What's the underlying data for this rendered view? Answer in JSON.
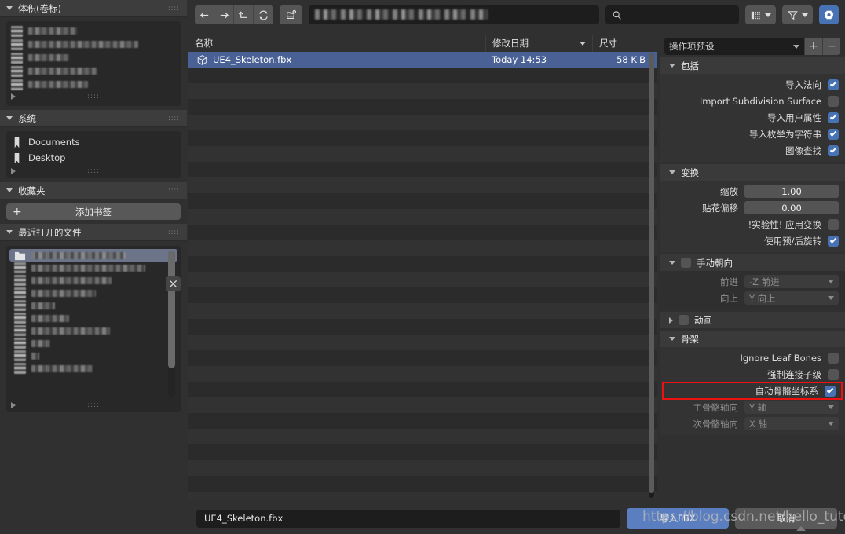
{
  "sidebar": {
    "volumes": {
      "title": "体积(卷标)",
      "items_blurred": 5
    },
    "system": {
      "title": "系统",
      "items": [
        {
          "label": "Documents",
          "icon": "bookmark-icon"
        },
        {
          "label": "Desktop",
          "icon": "bookmark-icon"
        }
      ]
    },
    "favorites": {
      "title": "收藏夹",
      "add_bookmark_label": "添加书签",
      "plus": "+"
    },
    "recent": {
      "title": "最近打开的文件",
      "rows_blurred": 11,
      "close_icon": "close-icon"
    }
  },
  "toolbar": {
    "back_icon": "arrow-left-icon",
    "forward_icon": "arrow-right-icon",
    "up_icon": "arrow-up-icon",
    "refresh_icon": "refresh-icon",
    "new_folder_icon": "new-folder-icon",
    "path_value": "",
    "search_placeholder": "",
    "search_icon": "search-icon",
    "display_mode_icon": "list-view-icon",
    "filter_icon": "filter-icon",
    "settings_icon": "gear-icon"
  },
  "filelist": {
    "columns": [
      "名称",
      "修改日期",
      "尺寸"
    ],
    "sort_column": "修改日期",
    "rows": [
      {
        "name": "UE4_Skeleton.fbx",
        "date": "Today 14:53",
        "size": "58 KiB",
        "icon": "mesh-cube-icon",
        "selected": true
      }
    ],
    "empty_row_count": 28
  },
  "rightpanel": {
    "preset": {
      "label": "操作项预设",
      "add": "+",
      "remove": "−"
    },
    "sections": [
      {
        "title": "包括",
        "expanded": true,
        "props": [
          {
            "label": "导入法向",
            "type": "checkbox",
            "checked": true
          },
          {
            "label": "Import Subdivision Surface",
            "type": "checkbox",
            "checked": false
          },
          {
            "label": "导入用户属性",
            "type": "checkbox",
            "checked": true
          },
          {
            "label": "导入枚举为字符串",
            "type": "checkbox",
            "checked": true
          },
          {
            "label": "图像查找",
            "type": "checkbox",
            "checked": true
          }
        ]
      },
      {
        "title": "变换",
        "expanded": true,
        "props": [
          {
            "label": "缩放",
            "type": "value",
            "value": "1.00"
          },
          {
            "label": "贴花偏移",
            "type": "value",
            "value": "0.00"
          },
          {
            "label": "!实验性! 应用变换",
            "type": "checkbox",
            "checked": false
          },
          {
            "label": "使用预/后旋转",
            "type": "checkbox",
            "checked": true
          }
        ]
      },
      {
        "title": "手动朝向",
        "expanded": true,
        "has_checkbox": true,
        "checked": false,
        "props": [
          {
            "label": "前进",
            "type": "select",
            "value": "-Z 前进",
            "disabled": true
          },
          {
            "label": "向上",
            "type": "select",
            "value": "Y 向上",
            "disabled": true
          }
        ]
      },
      {
        "title": "动画",
        "expanded": false,
        "has_checkbox": true,
        "checked": false,
        "props": []
      },
      {
        "title": "骨架",
        "expanded": true,
        "props": [
          {
            "label": "Ignore Leaf Bones",
            "type": "checkbox",
            "checked": false
          },
          {
            "label": "强制连接子级",
            "type": "checkbox",
            "checked": false
          },
          {
            "label": "自动骨骼坐标系",
            "type": "checkbox",
            "checked": true,
            "highlighted": true
          },
          {
            "label": "主骨骼轴向",
            "type": "select",
            "value": "Y 轴",
            "disabled": true
          },
          {
            "label": "次骨骼轴向",
            "type": "select",
            "value": "X 轴",
            "disabled": true
          }
        ]
      }
    ]
  },
  "bottombar": {
    "filename": "UE4_Skeleton.fbx",
    "import_label": "导入FBX",
    "cancel_label": "取消"
  },
  "watermark": {
    "text": "https://blog.csdn.net/hello_tute"
  },
  "colors": {
    "accent": "#4772b3",
    "selection": "#4a6195",
    "highlight": "#ee1111",
    "panel_bg": "#303030",
    "list_bg": "#232323"
  }
}
